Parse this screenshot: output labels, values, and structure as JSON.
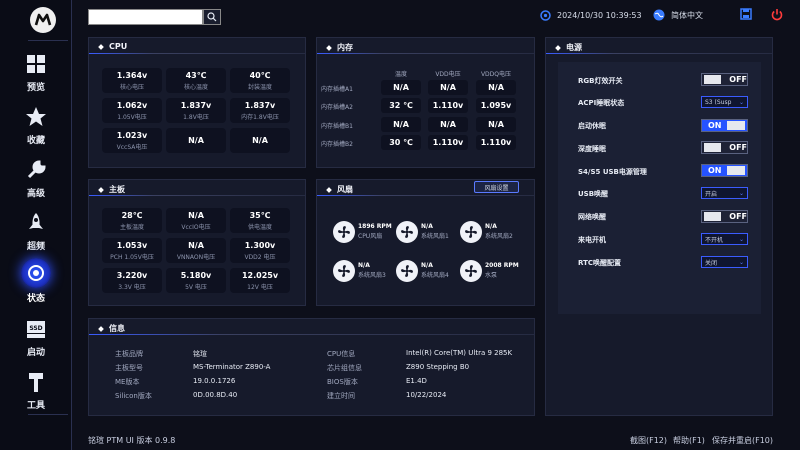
{
  "topbar": {
    "search_placeholder": "",
    "datetime": "2024/10/30 10:39:53",
    "language": "简体中文"
  },
  "sidebar": {
    "items": [
      {
        "label": "预览",
        "icon": "grid-icon"
      },
      {
        "label": "收藏",
        "icon": "star-icon"
      },
      {
        "label": "高级",
        "icon": "wrench-icon"
      },
      {
        "label": "超频",
        "icon": "rocket-icon"
      },
      {
        "label": "状态",
        "icon": "status-eye-icon",
        "active": true
      },
      {
        "label": "启动",
        "icon": "ssd-icon"
      },
      {
        "label": "工具",
        "icon": "hammer-icon"
      }
    ]
  },
  "cpu": {
    "title": "CPU",
    "tiles": [
      {
        "value": "1.364v",
        "label": "核心电压"
      },
      {
        "value": "43℃",
        "label": "核心温度"
      },
      {
        "value": "40℃",
        "label": "封装温度"
      },
      {
        "value": "1.062v",
        "label": "1.05V电压"
      },
      {
        "value": "1.837v",
        "label": "1.8V电压"
      },
      {
        "value": "1.837v",
        "label": "内存1.8V电压"
      },
      {
        "value": "1.023v",
        "label": "VccSA电压"
      },
      {
        "value": "N/A",
        "label": ""
      },
      {
        "value": "N/A",
        "label": ""
      }
    ]
  },
  "memory": {
    "title": "内存",
    "headers": [
      "温度",
      "VDD电压",
      "VDDQ电压"
    ],
    "rows": [
      {
        "label": "内存插槽A1",
        "values": [
          "N/A",
          "N/A",
          "N/A"
        ]
      },
      {
        "label": "内存插槽A2",
        "values": [
          "32 ℃",
          "1.110v",
          "1.095v"
        ]
      },
      {
        "label": "内存插槽B1",
        "values": [
          "N/A",
          "N/A",
          "N/A"
        ]
      },
      {
        "label": "内存插槽B2",
        "values": [
          "30 ℃",
          "1.110v",
          "1.110v"
        ]
      }
    ]
  },
  "board": {
    "title": "主板",
    "tiles": [
      {
        "value": "28℃",
        "label": "主板温度"
      },
      {
        "value": "N/A",
        "label": "VccIO电压"
      },
      {
        "value": "35℃",
        "label": "供电温度"
      },
      {
        "value": "1.053v",
        "label": "PCH 1.05V电压"
      },
      {
        "value": "N/A",
        "label": "VNNAON电压"
      },
      {
        "value": "1.300v",
        "label": "VDD2 电压"
      },
      {
        "value": "3.220v",
        "label": "3.3V 电压"
      },
      {
        "value": "5.180v",
        "label": "5V 电压"
      },
      {
        "value": "12.025v",
        "label": "12V 电压"
      }
    ]
  },
  "fans": {
    "title": "风扇",
    "settings_label": "风扇设置",
    "items": [
      {
        "value": "1896 RPM",
        "label": "CPU风扇"
      },
      {
        "value": "N/A",
        "label": "系统风扇1"
      },
      {
        "value": "N/A",
        "label": "系统风扇2"
      },
      {
        "value": "N/A",
        "label": "系统风扇3"
      },
      {
        "value": "N/A",
        "label": "系统风扇4"
      },
      {
        "value": "2008 RPM",
        "label": "水泵"
      }
    ]
  },
  "power": {
    "title": "电源",
    "rows": [
      {
        "label": "RGB灯效开关",
        "type": "toggle",
        "state": "OFF"
      },
      {
        "label": "ACPI睡眠状态",
        "type": "select",
        "value": "S3 (Susp"
      },
      {
        "label": "启动休眠",
        "type": "toggle",
        "state": "ON"
      },
      {
        "label": "深度睡眠",
        "type": "toggle",
        "state": "OFF"
      },
      {
        "label": "S4/S5 USB电源管理",
        "type": "toggle",
        "state": "ON"
      },
      {
        "label": "USB唤醒",
        "type": "select",
        "value": "开启"
      },
      {
        "label": "网络唤醒",
        "type": "toggle",
        "state": "OFF"
      },
      {
        "label": "来电开机",
        "type": "select",
        "value": "不开机"
      },
      {
        "label": "RTC唤醒配置",
        "type": "select",
        "value": "关闭"
      }
    ]
  },
  "info": {
    "title": "信息",
    "left": [
      {
        "label": "主板品牌",
        "value": "铭瑄"
      },
      {
        "label": "主板型号",
        "value": "MS-Terminator Z890-A"
      },
      {
        "label": "ME版本",
        "value": "19.0.0.1726"
      },
      {
        "label": "Silicon版本",
        "value": "0D.00.8D.40"
      }
    ],
    "right": [
      {
        "label": "CPU信息",
        "value": "Intel(R) Core(TM) Ultra 9 285K"
      },
      {
        "label": "芯片组信息",
        "value": "Z890 Stepping B0"
      },
      {
        "label": "BIOS版本",
        "value": "E1.4D"
      },
      {
        "label": "建立时间",
        "value": "10/22/2024"
      }
    ]
  },
  "footer": {
    "version": "铭瑄 PTM UI 版本 0.9.8",
    "screenshot": "截图(F12)",
    "help": "帮助(F1)",
    "save_restart": "保存并重启(F10)"
  },
  "colors": {
    "accent": "#2653ff",
    "background": "#0d0f1a",
    "panel": "#161a2b",
    "power_icon": "#ff3b3b"
  }
}
